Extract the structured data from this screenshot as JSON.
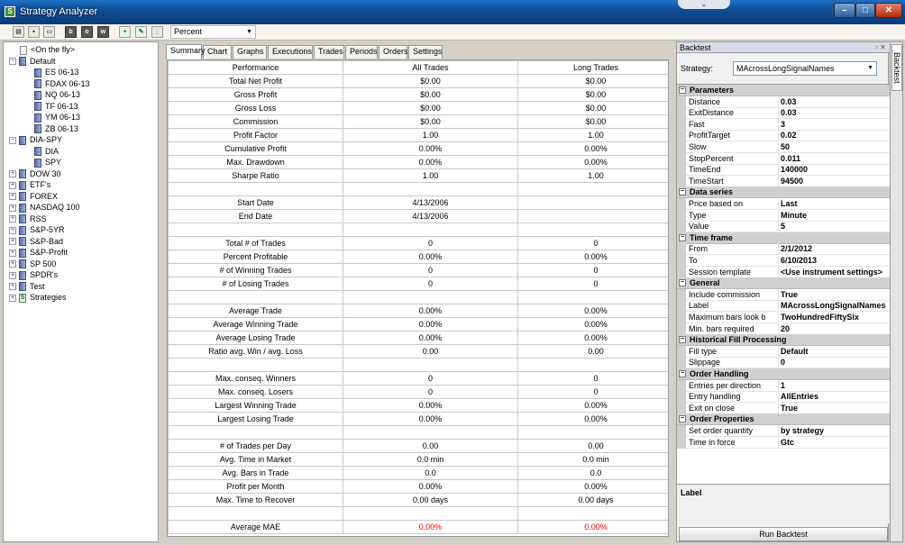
{
  "window": {
    "title": "Strategy Analyzer"
  },
  "toolbar": {
    "combo_value": "Percent",
    "buttons": [
      "open-folder",
      "save",
      "comment",
      "b",
      "o",
      "w",
      "add",
      "edit",
      "delete"
    ]
  },
  "tree": [
    {
      "label": "<On the fly>",
      "level": 0,
      "exp": ""
    },
    {
      "label": "Default",
      "level": 0,
      "exp": "−"
    },
    {
      "label": "ES 06-13",
      "level": 1
    },
    {
      "label": "FDAX 06-13",
      "level": 1
    },
    {
      "label": "NQ 06-13",
      "level": 1
    },
    {
      "label": "TF 06-13",
      "level": 1
    },
    {
      "label": "YM 06-13",
      "level": 1
    },
    {
      "label": "ZB 06-13",
      "level": 1
    },
    {
      "label": "DIA-SPY",
      "level": 0,
      "exp": "−"
    },
    {
      "label": "DIA",
      "level": 1
    },
    {
      "label": "SPY",
      "level": 1
    },
    {
      "label": "DOW 30",
      "level": 0,
      "exp": "+"
    },
    {
      "label": "ETF's",
      "level": 0,
      "exp": "+"
    },
    {
      "label": "FOREX",
      "level": 0,
      "exp": "+"
    },
    {
      "label": "NASDAQ 100",
      "level": 0,
      "exp": "+"
    },
    {
      "label": "RSS",
      "level": 0,
      "exp": "+"
    },
    {
      "label": "S&P-5YR",
      "level": 0,
      "exp": "+"
    },
    {
      "label": "S&P-Bad",
      "level": 0,
      "exp": "+"
    },
    {
      "label": "S&P-Profit",
      "level": 0,
      "exp": "+"
    },
    {
      "label": "SP 500",
      "level": 0,
      "exp": "+"
    },
    {
      "label": "SPDR's",
      "level": 0,
      "exp": "+"
    },
    {
      "label": "Test",
      "level": 0,
      "exp": "+"
    },
    {
      "label": "Strategies",
      "level": 0,
      "exp": "+",
      "icon": "strategy"
    }
  ],
  "tabs": [
    "Summary",
    "Chart",
    "Graphs",
    "Executions",
    "Trades",
    "Periods",
    "Orders",
    "Settings"
  ],
  "summary": {
    "headers": [
      "Performance",
      "All Trades",
      "Long Trades"
    ],
    "rows": [
      [
        "Total Net Profit",
        "$0.00",
        "$0.00"
      ],
      [
        "Gross Profit",
        "$0.00",
        "$0.00"
      ],
      [
        "Gross Loss",
        "$0.00",
        "$0.00"
      ],
      [
        "Commission",
        "$0.00",
        "$0.00"
      ],
      [
        "Profit Factor",
        "1.00",
        "1.00"
      ],
      [
        "Cumulative Profit",
        "0.00%",
        "0.00%"
      ],
      [
        "Max. Drawdown",
        "0.00%",
        "0.00%"
      ],
      [
        "Sharpe Ratio",
        "1.00",
        "1.00"
      ],
      [
        "",
        "",
        ""
      ],
      [
        "Start Date",
        "4/13/2006",
        ""
      ],
      [
        "End Date",
        "4/13/2006",
        ""
      ],
      [
        "",
        "",
        ""
      ],
      [
        "Total # of Trades",
        "0",
        "0"
      ],
      [
        "Percent Profitable",
        "0.00%",
        "0.00%"
      ],
      [
        "# of Winning Trades",
        "0",
        "0"
      ],
      [
        "# of Losing Trades",
        "0",
        "0"
      ],
      [
        "",
        "",
        ""
      ],
      [
        "Average Trade",
        "0.00%",
        "0.00%"
      ],
      [
        "Average Winning Trade",
        "0.00%",
        "0.00%"
      ],
      [
        "Average Losing Trade",
        "0.00%",
        "0.00%"
      ],
      [
        "Ratio avg. Win / avg. Loss",
        "0.00",
        "0.00"
      ],
      [
        "",
        "",
        ""
      ],
      [
        "Max. conseq. Winners",
        "0",
        "0"
      ],
      [
        "Max. conseq. Losers",
        "0",
        "0"
      ],
      [
        "Largest Winning Trade",
        "0.00%",
        "0.00%"
      ],
      [
        "Largest Losing Trade",
        "0.00%",
        "0.00%"
      ],
      [
        "",
        "",
        ""
      ],
      [
        "# of Trades per Day",
        "0.00",
        "0.00"
      ],
      [
        "Avg. Time in Market",
        "0.0 min",
        "0.0 min"
      ],
      [
        "Avg. Bars in Trade",
        "0.0",
        "0.0"
      ],
      [
        "Profit per Month",
        "0.00%",
        "0.00%"
      ],
      [
        "Max. Time to Recover",
        "0.00 days",
        "0.00 days"
      ],
      [
        "",
        "",
        ""
      ],
      [
        "Average MAE",
        "0.00%",
        "0.00%"
      ]
    ],
    "red_rows": [
      33
    ]
  },
  "backtest": {
    "title": "Backtest",
    "strategy_label": "Strategy:",
    "strategy_value": "MAcrossLongSignalNames",
    "categories": [
      {
        "name": "Parameters",
        "props": [
          [
            "Distance",
            "0.03"
          ],
          [
            "ExitDistance",
            "0.03"
          ],
          [
            "Fast",
            "3"
          ],
          [
            "ProfitTarget",
            "0.02"
          ],
          [
            "Slow",
            "50"
          ],
          [
            "StopPercent",
            "0.011"
          ],
          [
            "TimeEnd",
            "140000"
          ],
          [
            "TimeStart",
            "94500"
          ]
        ]
      },
      {
        "name": "Data series",
        "props": [
          [
            "Price based on",
            "Last"
          ],
          [
            "Type",
            "Minute"
          ],
          [
            "Value",
            "5"
          ]
        ]
      },
      {
        "name": "Time frame",
        "props": [
          [
            "From",
            "2/1/2012"
          ],
          [
            "To",
            "6/10/2013"
          ],
          [
            "Session template",
            "<Use instrument settings>"
          ]
        ]
      },
      {
        "name": "General",
        "props": [
          [
            "Include commission",
            "True"
          ],
          [
            "Label",
            "MAcrossLongSignalNames"
          ],
          [
            "Maximum bars look back",
            "TwoHundredFiftySix"
          ],
          [
            "Min. bars required",
            "20"
          ]
        ]
      },
      {
        "name": "Historical Fill Processing",
        "props": [
          [
            "Fill type",
            "Default"
          ],
          [
            "Slippage",
            "0"
          ]
        ]
      },
      {
        "name": "Order Handling",
        "props": [
          [
            "Entries per direction",
            "1"
          ],
          [
            "Entry handling",
            "AllEntries"
          ],
          [
            "Exit on close",
            "True"
          ]
        ]
      },
      {
        "name": "Order Properties",
        "props": [
          [
            "Set order quantity",
            "by strategy"
          ],
          [
            "Time in force",
            "Gtc"
          ]
        ]
      }
    ],
    "description_title": "Label",
    "run_label": "Run Backtest",
    "side_tab": "Backtest"
  }
}
